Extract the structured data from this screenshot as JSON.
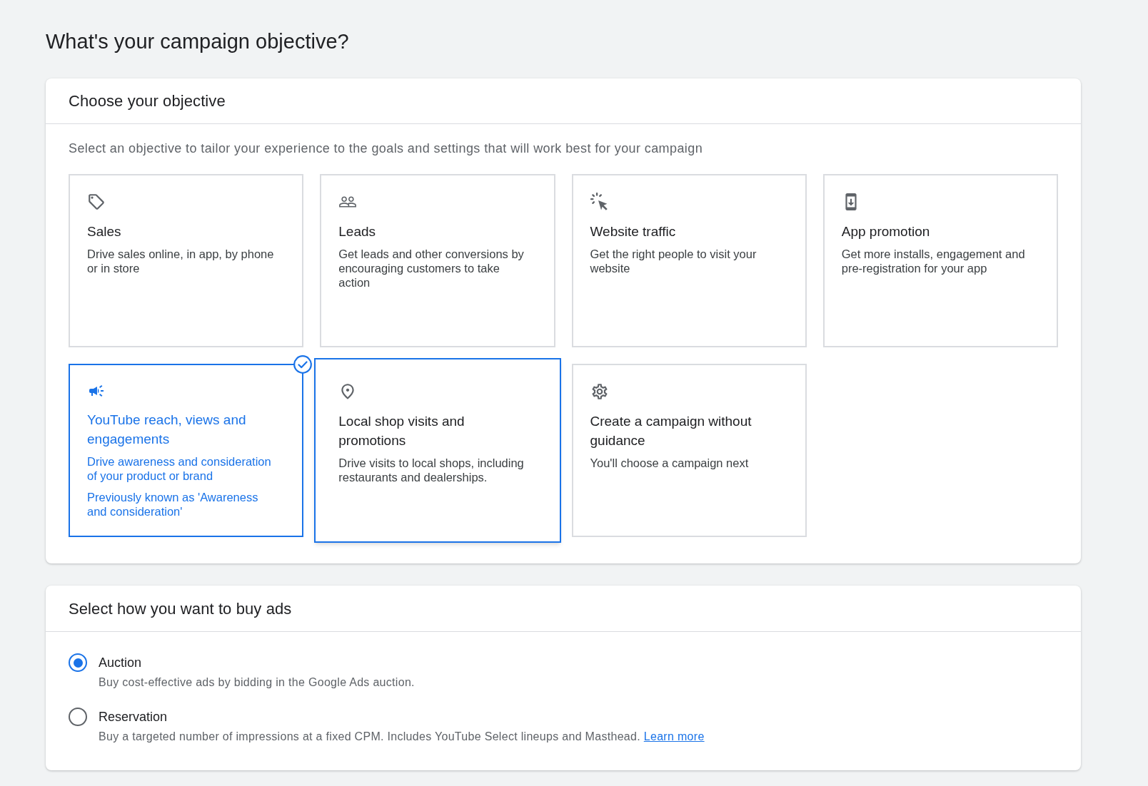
{
  "page": {
    "title": "What's your campaign objective?"
  },
  "objective_panel": {
    "heading": "Choose your objective",
    "description": "Select an objective to tailor your experience to the goals and settings that will work best for your campaign",
    "cards": [
      {
        "title": "Sales",
        "descriptions": [
          "Drive sales online, in app, by phone or in store"
        ],
        "selected": false,
        "focused": false
      },
      {
        "title": "Leads",
        "descriptions": [
          "Get leads and other conversions by encouraging customers to take action"
        ],
        "selected": false,
        "focused": false
      },
      {
        "title": "Website traffic",
        "descriptions": [
          "Get the right people to visit your website"
        ],
        "selected": false,
        "focused": false
      },
      {
        "title": "App promotion",
        "descriptions": [
          "Get more installs, engagement and pre-registration for your app"
        ],
        "selected": false,
        "focused": false
      },
      {
        "title": "YouTube reach, views and engagements",
        "descriptions": [
          "Drive awareness and consideration of your product or brand",
          "Previously known as 'Awareness and consideration'"
        ],
        "selected": true,
        "focused": false
      },
      {
        "title": "Local shop visits and promotions",
        "descriptions": [
          "Drive visits to local shops, including restaurants and dealerships."
        ],
        "selected": false,
        "focused": true
      },
      {
        "title": "Create a campaign without guidance",
        "descriptions": [
          "You'll choose a campaign next"
        ],
        "selected": false,
        "focused": false
      }
    ]
  },
  "buy_panel": {
    "heading": "Select how you want to buy ads",
    "options": [
      {
        "label": "Auction",
        "description": "Buy cost-effective ads by bidding in the Google Ads auction.",
        "selected": true
      },
      {
        "label": "Reservation",
        "description": "Buy a targeted number of impressions at a fixed CPM. Includes YouTube Select lineups and Masthead.",
        "link": "Learn more",
        "selected": false
      }
    ]
  }
}
